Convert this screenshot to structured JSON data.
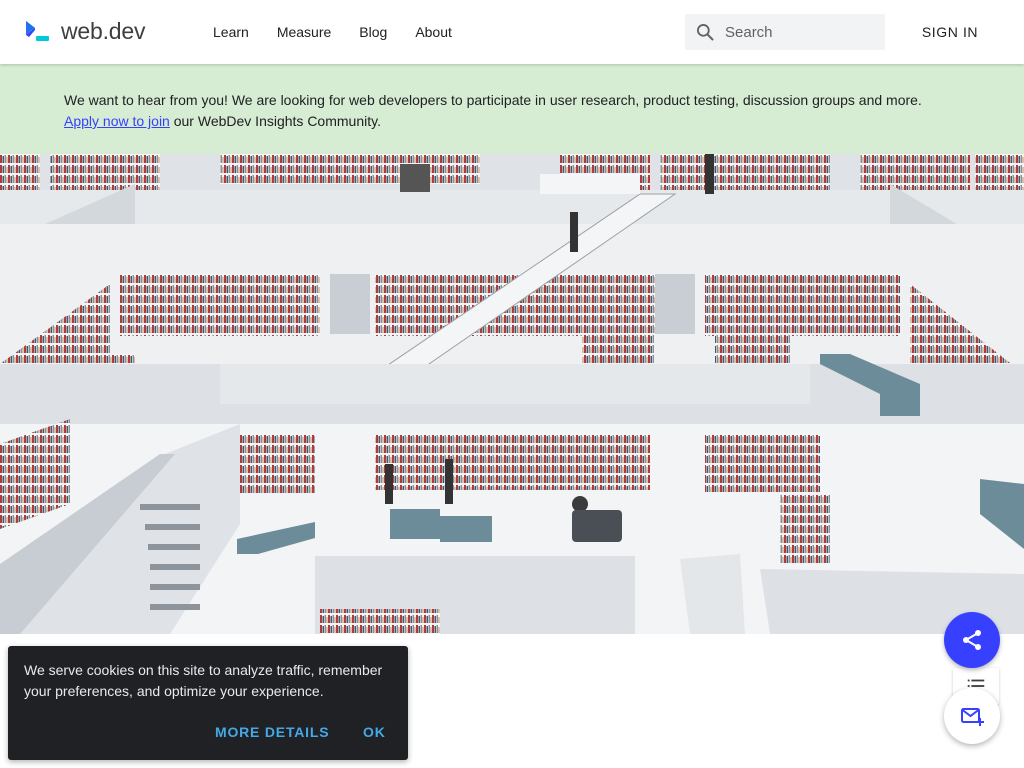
{
  "header": {
    "logo_text": "web.dev",
    "nav": [
      "Learn",
      "Measure",
      "Blog",
      "About"
    ],
    "search_placeholder": "Search",
    "signin_label": "SIGN IN"
  },
  "banner": {
    "text_before": "We want to hear from you! We are looking for web developers to participate in user research, product testing, discussion groups and more.",
    "link_text": "Apply now to join",
    "text_after": " our WebDev Insights Community."
  },
  "cookie": {
    "text": "We serve cookies on this site to analyze traffic, remember your preferences, and optimize your experience.",
    "more_details": "MORE DETAILS",
    "ok": "OK"
  },
  "fabs": {
    "share_icon": "share-icon",
    "toc_icon": "list-icon",
    "subscribe_icon": "mail-add-icon"
  },
  "colors": {
    "brand": "#3740ff",
    "banner_bg": "#d6ecd3",
    "cookie_bg": "#202124",
    "cookie_action": "#45a8e7"
  },
  "hero": {
    "icon": "library-photo"
  }
}
